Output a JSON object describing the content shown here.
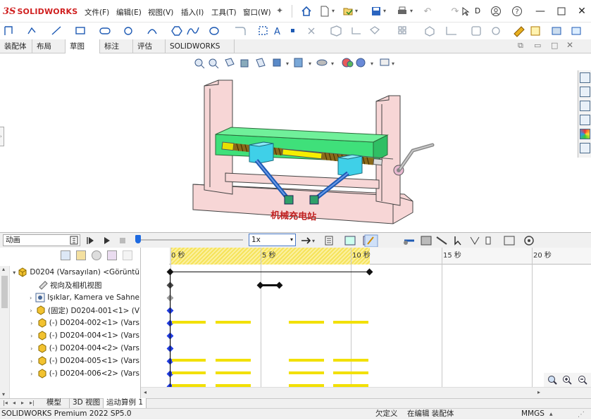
{
  "app": {
    "brand_ds": "3S",
    "brand_name": "SOLIDWORKS"
  },
  "menu": [
    "文件(F)",
    "编辑(E)",
    "视图(V)",
    "插入(I)",
    "工具(T)",
    "窗口(W)"
  ],
  "title_short": "D",
  "tabs": [
    "装配体",
    "布局",
    "草图",
    "标注",
    "评估",
    "SOLIDWORKS 插件"
  ],
  "active_tab": "草图",
  "viewport": {
    "watermark": "机械充电站"
  },
  "motion": {
    "study_type": "动画",
    "speed": "1x",
    "ticks": [
      "0 秒",
      "5 秒",
      "10 秒",
      "15 秒",
      "20 秒"
    ]
  },
  "tree": [
    {
      "label": "D0204 (Varsayılan) <Görüntü",
      "icon": "assembly-icon"
    },
    {
      "label": "视向及相机视图",
      "icon": "camera-icon"
    },
    {
      "label": "Işıklar, Kamera ve Sahne",
      "icon": "lights-icon"
    },
    {
      "label": "(固定) D0204-001<1> (V",
      "icon": "part-icon"
    },
    {
      "label": "(-) D0204-002<1> (Vars",
      "icon": "part-icon"
    },
    {
      "label": "(-) D0204-004<1> (Vars",
      "icon": "part-icon"
    },
    {
      "label": "(-) D0204-004<2> (Vars",
      "icon": "part-icon"
    },
    {
      "label": "(-) D0204-005<1> (Vars",
      "icon": "part-icon"
    },
    {
      "label": "(-) D0204-006<2> (Vars",
      "icon": "part-icon"
    }
  ],
  "bottom_tabs": [
    "模型",
    "3D 视图",
    "运动算例 1"
  ],
  "status": {
    "product": "SOLIDWORKS Premium 2022 SP5.0",
    "defined": "欠定义",
    "editing": "在编辑 装配体",
    "units": "MMGS"
  },
  "colors": {
    "accent": "#1e5ab4",
    "timeline_yellow": "#f2e000",
    "frame_pink": "#f7d6d6",
    "slider_green": "#3fe07a",
    "block_cyan": "#3fd0e8"
  }
}
